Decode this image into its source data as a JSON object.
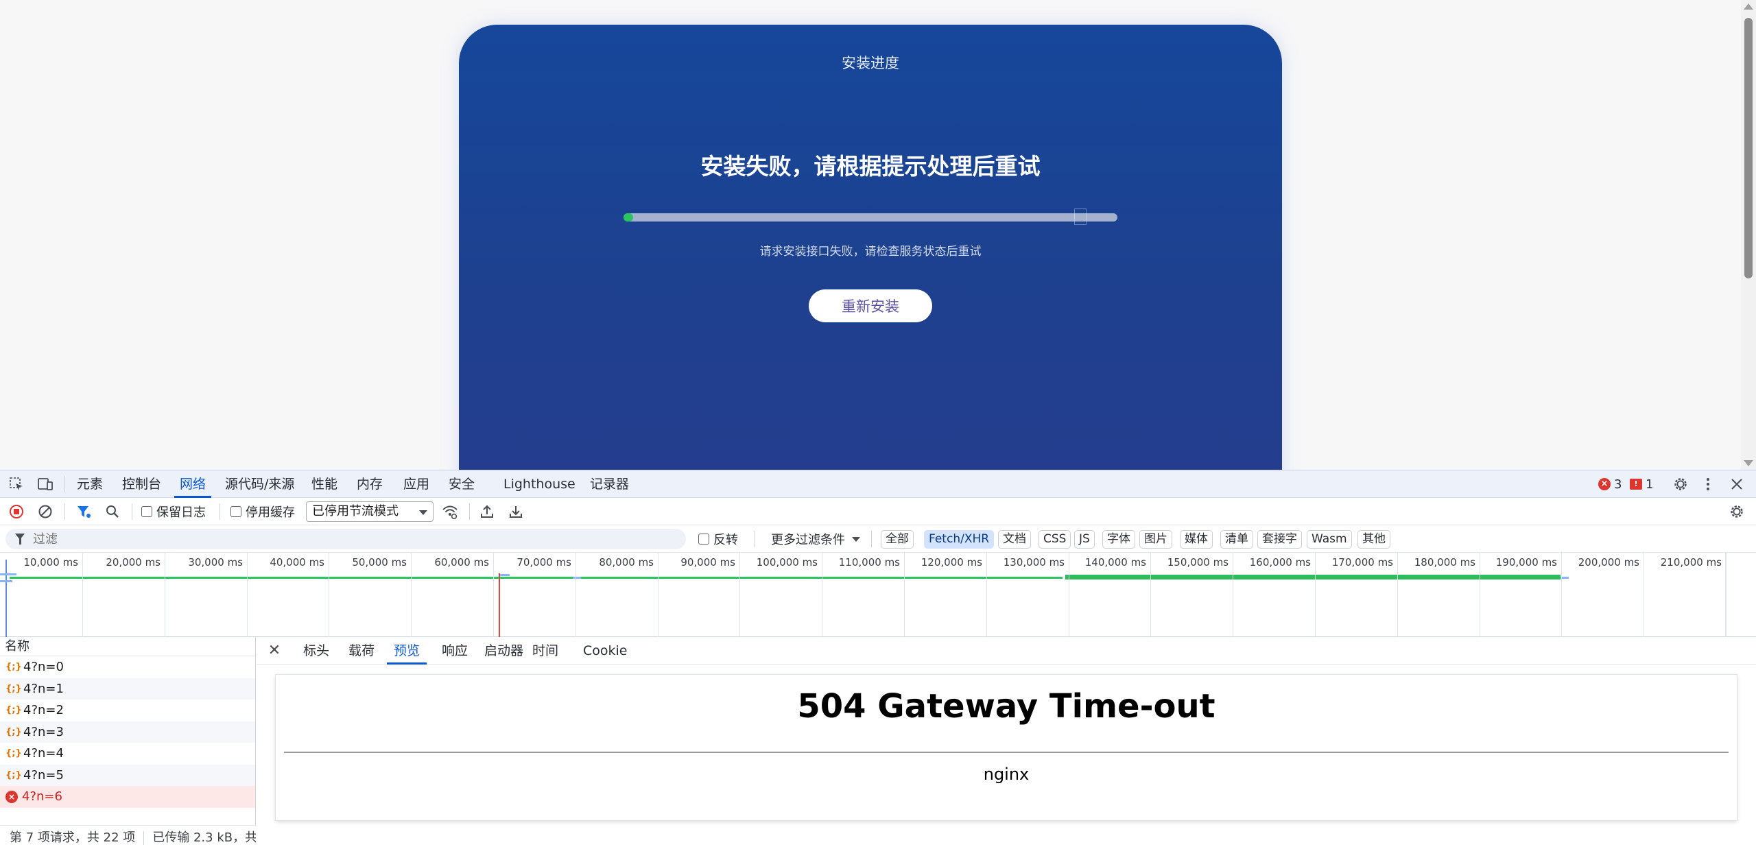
{
  "page": {
    "card_title": "安装进度",
    "headline": "安装失败，请根据提示处理后重试",
    "progress": 0.02,
    "message": "请求安装接口失败，请检查服务状态后重试",
    "retry_label": "重新安装"
  },
  "devtools": {
    "tabs": [
      "元素",
      "控制台",
      "网络",
      "源代码/来源",
      "性能",
      "内存",
      "应用",
      "安全",
      "Lighthouse",
      "记录器"
    ],
    "active_tab": "网络",
    "error_count": "3",
    "issue_count": "1",
    "toolbar": {
      "preserve_log": "保留日志",
      "disable_cache": "停用缓存",
      "throttle": "已停用节流模式"
    },
    "filter": {
      "placeholder": "过滤",
      "invert": "反转",
      "more_filters": "更多过滤条件",
      "types": [
        "全部",
        "Fetch/XHR",
        "文档",
        "CSS",
        "JS",
        "字体",
        "图片",
        "媒体",
        "清单",
        "套接字",
        "Wasm",
        "其他"
      ],
      "active_type": "Fetch/XHR"
    },
    "overview": {
      "tick_labels": [
        "10,000 ms",
        "20,000 ms",
        "30,000 ms",
        "40,000 ms",
        "50,000 ms",
        "60,000 ms",
        "70,000 ms",
        "80,000 ms",
        "90,000 ms",
        "100,000 ms",
        "110,000 ms",
        "120,000 ms",
        "130,000 ms",
        "140,000 ms",
        "150,000 ms",
        "160,000 ms",
        "170,000 ms",
        "180,000 ms",
        "190,000 ms",
        "200,000 ms",
        "210,000 ms"
      ]
    },
    "list": {
      "header": "名称",
      "rows": [
        {
          "name": "4?n=0",
          "status": "ok"
        },
        {
          "name": "4?n=1",
          "status": "ok"
        },
        {
          "name": "4?n=2",
          "status": "ok"
        },
        {
          "name": "4?n=3",
          "status": "ok"
        },
        {
          "name": "4?n=4",
          "status": "ok"
        },
        {
          "name": "4?n=5",
          "status": "ok"
        },
        {
          "name": "4?n=6",
          "status": "error"
        }
      ],
      "footer_requests": "第 7 项请求，共 22 项",
      "footer_transferred": "已传输 2.3 kB，共"
    },
    "detail": {
      "tabs": [
        "标头",
        "载荷",
        "预览",
        "响应",
        "启动器",
        "时间",
        "Cookie"
      ],
      "active_tab": "预览",
      "preview_title": "504 Gateway Time-out",
      "preview_server": "nginx"
    }
  },
  "colors": {
    "card_top": "#16479a",
    "card_bottom": "#273c8e",
    "progress_fill": "#2cc45f",
    "accent": "#0b57d0",
    "error": "#dc362e"
  }
}
